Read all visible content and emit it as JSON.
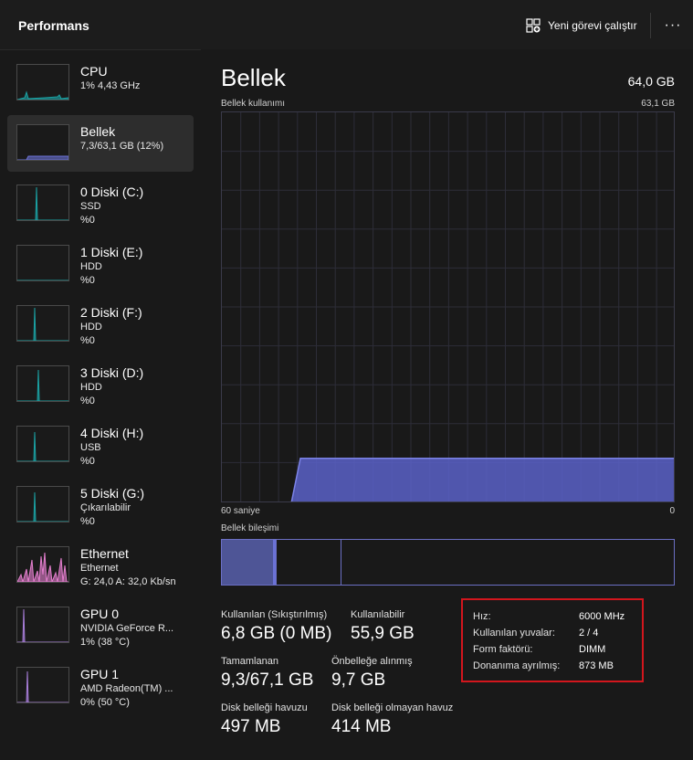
{
  "header": {
    "title": "Performans",
    "run_task_label": "Yeni görevi çalıştır",
    "run_task_icon": "new-task-icon",
    "more_icon": "more-options-icon",
    "more_label": "···"
  },
  "sidebar": {
    "items": [
      {
        "name": "CPU",
        "sub1": "1% 4,43 GHz",
        "sub2": "",
        "color": "#1ba1a3",
        "selected": false
      },
      {
        "name": "Bellek",
        "sub1": "7,3/63,1 GB (12%)",
        "sub2": "",
        "color": "#6b72d6",
        "selected": true
      },
      {
        "name": "0 Diski (C:)",
        "sub1": "SSD",
        "sub2": "%0",
        "color": "#1ba1a3",
        "selected": false
      },
      {
        "name": "1 Diski (E:)",
        "sub1": "HDD",
        "sub2": "%0",
        "color": "#1ba1a3",
        "selected": false
      },
      {
        "name": "2 Diski (F:)",
        "sub1": "HDD",
        "sub2": "%0",
        "color": "#1ba1a3",
        "selected": false
      },
      {
        "name": "3 Diski (D:)",
        "sub1": "HDD",
        "sub2": "%0",
        "color": "#1ba1a3",
        "selected": false
      },
      {
        "name": "4 Diski (H:)",
        "sub1": "USB",
        "sub2": "%0",
        "color": "#1ba1a3",
        "selected": false
      },
      {
        "name": "5 Diski (G:)",
        "sub1": "Çıkarılabilir",
        "sub2": "%0",
        "color": "#1ba1a3",
        "selected": false
      },
      {
        "name": "Ethernet",
        "sub1": "Ethernet",
        "sub2": "G: 24,0 A: 32,0 Kb/sn",
        "color": "#e57fcf",
        "selected": false
      },
      {
        "name": "GPU 0",
        "sub1": "NVIDIA GeForce R...",
        "sub2": "1% (38 °C)",
        "color": "#a77dd8",
        "selected": false
      },
      {
        "name": "GPU 1",
        "sub1": "AMD Radeon(TM) ...",
        "sub2": "0% (50 °C)",
        "color": "#a77dd8",
        "selected": false
      }
    ]
  },
  "main": {
    "title": "Bellek",
    "total": "64,0 GB",
    "graph_label": "Bellek kullanımı",
    "graph_max": "63,1 GB",
    "graph_time": "60 saniye",
    "graph_zero": "0",
    "composition_label": "Bellek bileşimi",
    "usage_fraction": 0.115,
    "usage_color": "#6b72d6",
    "stats": {
      "used_label": "Kullanılan (Sıkıştırılmış)",
      "used_value": "6,8 GB (0 MB)",
      "available_label": "Kullanılabilir",
      "available_value": "55,9 GB",
      "committed_label": "Tamamlanan",
      "committed_value": "9,3/67,1 GB",
      "cached_label": "Önbelleğe alınmış",
      "cached_value": "9,7 GB",
      "paged_label": "Disk belleği havuzu",
      "paged_value": "497 MB",
      "nonpaged_label": "Disk belleği olmayan havuz",
      "nonpaged_value": "414 MB"
    },
    "info": {
      "speed_label": "Hız:",
      "speed_value": "6000 MHz",
      "slots_label": "Kullanılan yuvalar:",
      "slots_value": "2 / 4",
      "form_label": "Form faktörü:",
      "form_value": "DIMM",
      "reserved_label": "Donanıma ayrılmış:",
      "reserved_value": "873 MB"
    }
  }
}
